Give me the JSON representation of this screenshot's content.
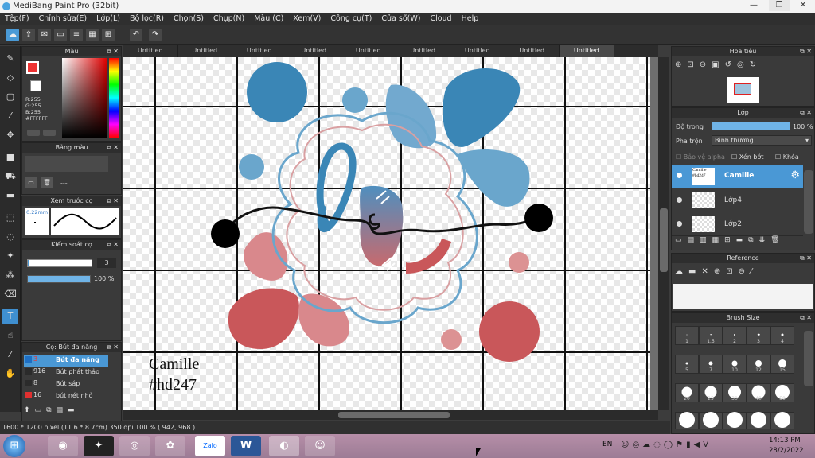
{
  "window": {
    "title": "MediBang Paint Pro (32bit)",
    "minimize": "—",
    "maximize": "❐",
    "close": "✕"
  },
  "menu": [
    "Tệp(F)",
    "Chỉnh sửa(E)",
    "Lớp(L)",
    "Bộ lọc(R)",
    "Chọn(S)",
    "Chụp(N)",
    "Màu (C)",
    "Xem(V)",
    "Công cụ(T)",
    "Cửa sổ(W)",
    "Cloud",
    "Help"
  ],
  "tabs": [
    "Untitled",
    "Untitled",
    "Untitled",
    "Untitled",
    "Untitled",
    "Untitled",
    "Untitled",
    "Untitled",
    "Untitled"
  ],
  "color_panel": {
    "title": "Màu",
    "r": "R:255",
    "g": "G:255",
    "b": "B:255",
    "hex": "#FFFFFF"
  },
  "palette_panel": {
    "title": "Bảng màu",
    "value": "---"
  },
  "preview_panel": {
    "title": "Xem trước cọ",
    "size": "0.22mm"
  },
  "control_panel": {
    "title": "Kiểm soát cọ",
    "size_value": "3",
    "opacity_value": "100 %",
    "opacity_fraction": 1.0
  },
  "brush_panel": {
    "title": "Cọ: Bút đa năng",
    "items": [
      {
        "size": "3",
        "name": "Bút đa năng",
        "color": "#1e6fc4"
      },
      {
        "size": "916",
        "name": "Bút phát thảo",
        "color": "#2b2b2b"
      },
      {
        "size": "8",
        "name": "Bút sáp",
        "color": "#2b2b2b"
      },
      {
        "size": "16",
        "name": "bút nét nhỏ",
        "color": "#e03030"
      }
    ]
  },
  "navigator_panel": {
    "title": "Hoa tiêu"
  },
  "layer_panel": {
    "title": "Lớp",
    "opacity_label": "Độ trong",
    "opacity_value": "100 %",
    "blend_label": "Pha trộn",
    "blend_value": "Bình thường",
    "protect_alpha": "Bảo vệ alpha",
    "clipping": "Xén bớt",
    "lock": "Khóa",
    "layers": [
      {
        "name": "Camille",
        "thumb": "Camille #hd247"
      },
      {
        "name": "Lớp4",
        "thumb": ""
      },
      {
        "name": "Lớp2",
        "thumb": ""
      }
    ]
  },
  "reference_panel": {
    "title": "Reference"
  },
  "brush_size_panel": {
    "title": "Brush Size",
    "sizes": [
      "1",
      "1.5",
      "2",
      "3",
      "4",
      "5",
      "7",
      "10",
      "12",
      "15",
      "20",
      "25",
      "30",
      "40",
      "50"
    ]
  },
  "canvas": {
    "text_line1": "Camille",
    "text_line2": "#hd247"
  },
  "status": {
    "text": "1600 * 1200 pixel  (11.6 * 8.7cm)  350 dpi  100 %  ( 942, 968 )"
  },
  "taskbar": {
    "lang": "EN",
    "time": "14:13 PM",
    "date": "28/2/2022",
    "zalo": "Zalo",
    "word": "W"
  },
  "colors": {
    "accent": "#4a98d5",
    "blue_drop": "#3f86b3",
    "light_blue": "#6fa8cc",
    "red_drop": "#c9575a",
    "pink": "#d79a9b"
  }
}
